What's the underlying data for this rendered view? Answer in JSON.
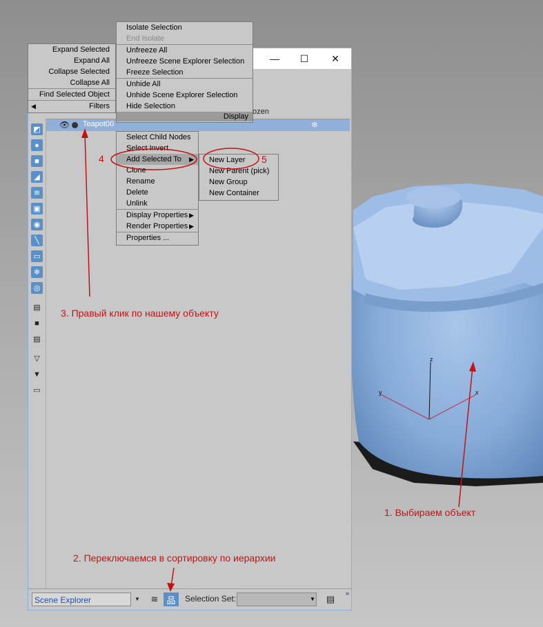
{
  "window": {
    "close_glyph": "✕",
    "maximize_glyph": "☐",
    "minimize_glyph": "—"
  },
  "table": {
    "column_frozen": "ozen",
    "row_name": "Teapot00",
    "row_frozen_icon": "snowflake-icon"
  },
  "left_toolbar_icons": [
    "geometry-icon",
    "light-icon",
    "camera-icon",
    "helper-icon",
    "spacewarp-icon",
    "group-icon",
    "xref-icon",
    "bone-icon",
    "container-icon",
    "frozen-icon",
    "hidden-icon",
    "display-all-icon",
    "display-none-icon",
    "display-invert-icon",
    "filter-icon",
    "filter-funnel-icon",
    "sync-selection-icon"
  ],
  "bottom": {
    "explorer_name": "Scene Explorer",
    "selection_set_label": "Selection Set:",
    "selection_set_value": ""
  },
  "left_menu": {
    "items": [
      "Expand Selected",
      "Expand All",
      "Collapse Selected",
      "Collapse All",
      "Find Selected Object",
      "Filters"
    ]
  },
  "display_menu": {
    "group1": [
      "Isolate Selection",
      "End Isolate"
    ],
    "group2": [
      "Unfreeze All",
      "Unfreeze Scene Explorer Selection",
      "Freeze Selection"
    ],
    "group3": [
      "Unhide All",
      "Unhide Scene Explorer Selection",
      "Hide Selection"
    ],
    "section_label": "Display"
  },
  "context_menu": {
    "items": [
      "Select Child Nodes",
      "Select Invert",
      "Add Selected To",
      "Clone",
      "Rename",
      "Delete",
      "Unlink",
      "Display Properties",
      "Render Properties",
      "Properties ..."
    ]
  },
  "submenu": {
    "items": [
      "New Layer",
      "New Parent (pick)",
      "New Group",
      "New Container"
    ]
  },
  "annotations": {
    "step1": "1. Выбираем объект",
    "step2": "2. Переключаемся в сортировку по иерархии",
    "step3": "3. Правый клик по нашему объекту",
    "step4": "4",
    "step5": "5"
  },
  "colors": {
    "annotation": "#c41212",
    "selection": "#90b0d9",
    "teapot": "#8fb2dc",
    "active_button": "#5b8fc8"
  }
}
